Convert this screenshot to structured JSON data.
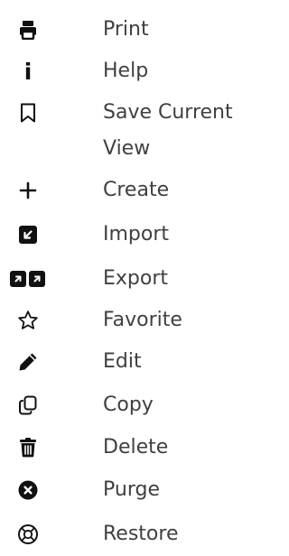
{
  "menu": {
    "items": [
      {
        "id": "print",
        "label": "Print",
        "icon": "print-icon"
      },
      {
        "id": "help",
        "label": "Help",
        "icon": "info-icon"
      },
      {
        "id": "save-current-view",
        "label": "Save Current View",
        "icon": "bookmark-icon"
      },
      {
        "id": "create",
        "label": "Create",
        "icon": "plus-icon"
      },
      {
        "id": "import",
        "label": "Import",
        "icon": "import-icon"
      },
      {
        "id": "export",
        "label": "Export",
        "icon": "export-icon"
      },
      {
        "id": "favorite",
        "label": "Favorite",
        "icon": "star-icon"
      },
      {
        "id": "edit",
        "label": "Edit",
        "icon": "pencil-icon"
      },
      {
        "id": "copy",
        "label": "Copy",
        "icon": "copy-icon"
      },
      {
        "id": "delete",
        "label": "Delete",
        "icon": "trash-icon"
      },
      {
        "id": "purge",
        "label": "Purge",
        "icon": "close-circle-icon"
      },
      {
        "id": "restore",
        "label": "Restore",
        "icon": "restore-icon"
      }
    ],
    "colors": {
      "text": "#404040",
      "icon": "#111111",
      "background": "#ffffff"
    }
  }
}
